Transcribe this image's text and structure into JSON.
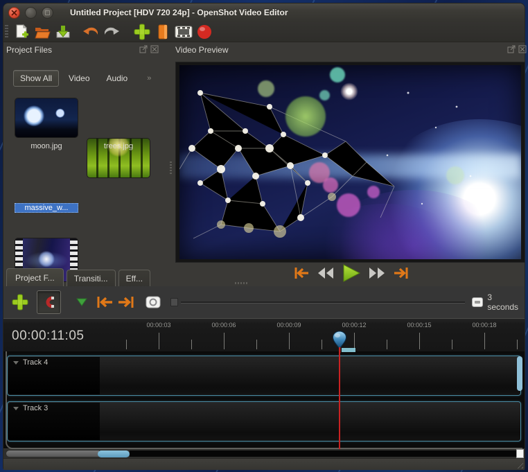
{
  "window": {
    "title": "Untitled Project [HDV 720 24p] - OpenShot Video Editor",
    "controls": [
      "close",
      "minimize",
      "maximize"
    ]
  },
  "toolbar": {
    "icons": [
      "new-project",
      "open-project",
      "save-project",
      "undo",
      "redo",
      "import-files",
      "choose-profile",
      "export-video",
      "record"
    ]
  },
  "project_files": {
    "title": "Project Files",
    "filters": [
      "Show All",
      "Video",
      "Audio"
    ],
    "selected_filter": "Show All",
    "overflow_glyph": "»",
    "files": [
      {
        "label": "moon.jpg",
        "type": "image",
        "selected": false
      },
      {
        "label": "trees.jpg",
        "type": "image",
        "selected": false
      },
      {
        "label": "massive_w...",
        "type": "video",
        "selected": true
      }
    ]
  },
  "video_preview": {
    "title": "Video Preview",
    "transport_icons": [
      "jump-to-start",
      "rewind",
      "play",
      "fast-forward",
      "jump-to-end"
    ]
  },
  "panel_tabs": {
    "tabs": [
      "Project F...",
      "Transiti...",
      "Eff..."
    ],
    "selected": "Project F..."
  },
  "timeline": {
    "toolbar_icons": [
      "add-track",
      "snapping-toggle",
      "razor-tool",
      "previous-marker",
      "next-marker",
      "center-playhead",
      "zoom-slider",
      "zoom-scale"
    ],
    "zoom_label": "3 seconds",
    "current_position": "00:00:11:05",
    "ruler_marks": [
      "00:00:03",
      "00:00:06",
      "00:00:09",
      "00:00:12",
      "00:00:15",
      "00:00:18"
    ],
    "tracks": [
      {
        "label": "Track 4"
      },
      {
        "label": "Track 3"
      }
    ],
    "colors": {
      "track_border": "#4b8ba3",
      "playhead": "#c92222",
      "scrollbar_thumb": "#8fc0d8",
      "play_button": "#7ec21f",
      "marker_orange": "#e07818"
    }
  }
}
